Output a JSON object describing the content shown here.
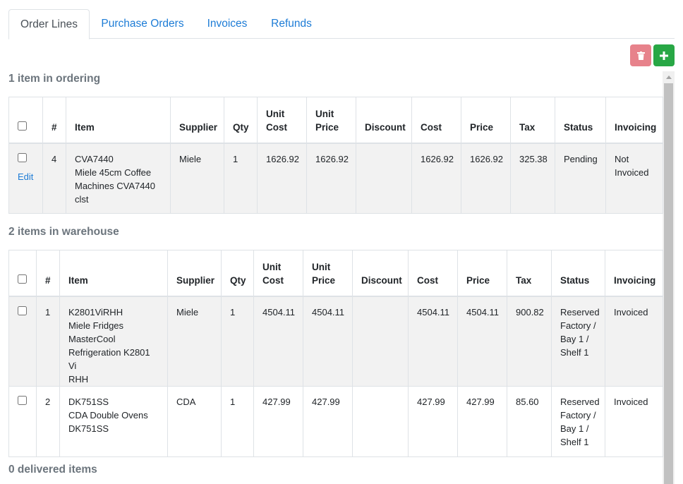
{
  "tabs": [
    {
      "label": "Order Lines",
      "active": true
    },
    {
      "label": "Purchase Orders",
      "active": false
    },
    {
      "label": "Invoices",
      "active": false
    },
    {
      "label": "Refunds",
      "active": false
    }
  ],
  "toolbar": {
    "delete_icon": "trash-icon",
    "add_icon": "plus-icon",
    "delete_color": "#e7828b",
    "add_color": "#28a745"
  },
  "columns": {
    "number": "#",
    "item": "Item",
    "supplier": "Supplier",
    "qty": "Qty",
    "unit_cost": [
      "Unit",
      "Cost"
    ],
    "unit_price": [
      "Unit",
      "Price"
    ],
    "discount": "Discount",
    "cost": "Cost",
    "price": "Price",
    "tax": "Tax",
    "status": "Status",
    "invoicing": "Invoicing"
  },
  "sections": {
    "ordering": {
      "title": "1 item in ordering",
      "rows": [
        {
          "number": "4",
          "edit_label": "Edit",
          "item_lines": [
            "CVA7440",
            "Miele 45cm Coffee",
            "Machines CVA7440",
            "clst"
          ],
          "supplier": "Miele",
          "qty": "1",
          "unit_cost": "1626.92",
          "unit_price": "1626.92",
          "discount": "",
          "cost": "1626.92",
          "price": "1626.92",
          "tax": "325.38",
          "status_lines": [
            "Pending"
          ],
          "invoicing_lines": [
            "Not",
            "Invoiced"
          ]
        }
      ]
    },
    "warehouse": {
      "title": "2 items in warehouse",
      "rows": [
        {
          "number": "1",
          "item_lines": [
            "K2801ViRHH",
            "Miele Fridges",
            "MasterCool",
            "Refrigeration K2801 Vi",
            "RHH"
          ],
          "supplier": "Miele",
          "qty": "1",
          "unit_cost": "4504.11",
          "unit_price": "4504.11",
          "discount": "",
          "cost": "4504.11",
          "price": "4504.11",
          "tax": "900.82",
          "status_lines": [
            "Reserved",
            "Factory /",
            "Bay 1 /",
            "Shelf 1"
          ],
          "invoicing_lines": [
            "Invoiced"
          ]
        },
        {
          "number": "2",
          "item_lines": [
            "DK751SS",
            "CDA Double Ovens",
            "DK751SS"
          ],
          "supplier": "CDA",
          "qty": "1",
          "unit_cost": "427.99",
          "unit_price": "427.99",
          "discount": "",
          "cost": "427.99",
          "price": "427.99",
          "tax": "85.60",
          "status_lines": [
            "Reserved",
            "Factory /",
            "Bay 1 /",
            "Shelf 1"
          ],
          "invoicing_lines": [
            "Invoiced"
          ]
        }
      ]
    },
    "delivered": {
      "title": "0 delivered items"
    }
  }
}
